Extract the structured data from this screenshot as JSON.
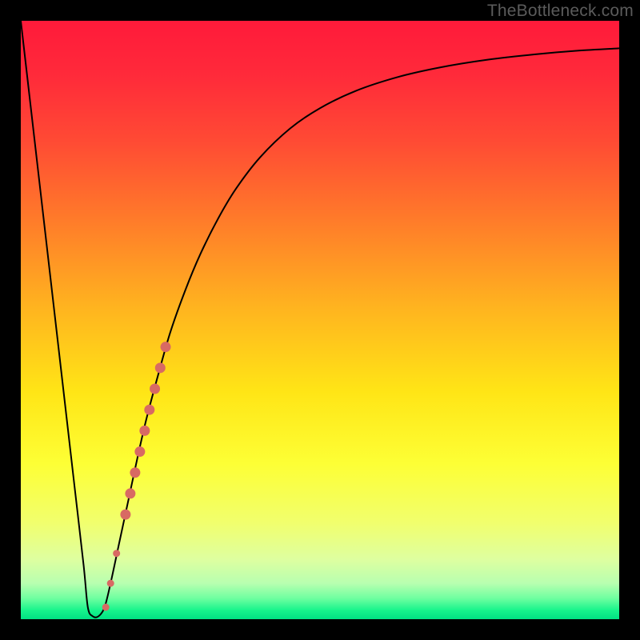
{
  "watermark": "TheBottleneck.com",
  "chart_data": {
    "type": "line",
    "title": "",
    "xlabel": "",
    "ylabel": "",
    "xlim": [
      0,
      100
    ],
    "ylim": [
      0,
      100
    ],
    "background_gradient": {
      "stops": [
        {
          "offset": 0.0,
          "color": "#ff1a3a"
        },
        {
          "offset": 0.09,
          "color": "#ff2a3a"
        },
        {
          "offset": 0.2,
          "color": "#ff4a34"
        },
        {
          "offset": 0.33,
          "color": "#ff7a2a"
        },
        {
          "offset": 0.48,
          "color": "#ffb41f"
        },
        {
          "offset": 0.62,
          "color": "#ffe516"
        },
        {
          "offset": 0.74,
          "color": "#fdff35"
        },
        {
          "offset": 0.84,
          "color": "#f1ff6e"
        },
        {
          "offset": 0.9,
          "color": "#deffa0"
        },
        {
          "offset": 0.94,
          "color": "#b8ffb0"
        },
        {
          "offset": 0.965,
          "color": "#6fffa0"
        },
        {
          "offset": 0.985,
          "color": "#18f48c"
        },
        {
          "offset": 1.0,
          "color": "#00e183"
        }
      ]
    },
    "series": [
      {
        "name": "bottleneck-curve",
        "stroke": "#000000",
        "stroke_width": 2,
        "x": [
          0.0,
          1.5,
          3.0,
          4.5,
          6.0,
          7.5,
          9.0,
          10.5,
          11.2,
          12.0,
          13.0,
          14.0,
          15.0,
          16.5,
          18.0,
          19.5,
          21.0,
          23.0,
          25.0,
          27.5,
          30.0,
          33.0,
          36.0,
          40.0,
          45.0,
          50.0,
          56.0,
          63.0,
          70.0,
          78.0,
          86.0,
          93.0,
          100.0
        ],
        "y": [
          100.0,
          87.0,
          74.0,
          61.0,
          48.0,
          35.0,
          22.0,
          9.0,
          2.0,
          0.5,
          0.5,
          2.0,
          6.0,
          13.0,
          20.0,
          27.0,
          33.5,
          41.0,
          48.0,
          55.0,
          61.0,
          67.0,
          72.0,
          77.2,
          82.0,
          85.4,
          88.3,
          90.6,
          92.2,
          93.5,
          94.4,
          95.0,
          95.4
        ]
      }
    ],
    "markers": {
      "name": "highlight-dots",
      "color": "#d86a63",
      "points": [
        {
          "x": 14.2,
          "y": 2.0,
          "r": 4.5
        },
        {
          "x": 15.0,
          "y": 6.0,
          "r": 4.5
        },
        {
          "x": 16.0,
          "y": 11.0,
          "r": 4.5
        },
        {
          "x": 17.5,
          "y": 17.5,
          "r": 6.5
        },
        {
          "x": 18.3,
          "y": 21.0,
          "r": 6.5
        },
        {
          "x": 19.1,
          "y": 24.5,
          "r": 6.5
        },
        {
          "x": 19.9,
          "y": 28.0,
          "r": 6.5
        },
        {
          "x": 20.7,
          "y": 31.5,
          "r": 6.5
        },
        {
          "x": 21.5,
          "y": 35.0,
          "r": 6.5
        },
        {
          "x": 22.4,
          "y": 38.5,
          "r": 6.5
        },
        {
          "x": 23.3,
          "y": 42.0,
          "r": 6.5
        },
        {
          "x": 24.2,
          "y": 45.5,
          "r": 6.5
        }
      ]
    }
  }
}
